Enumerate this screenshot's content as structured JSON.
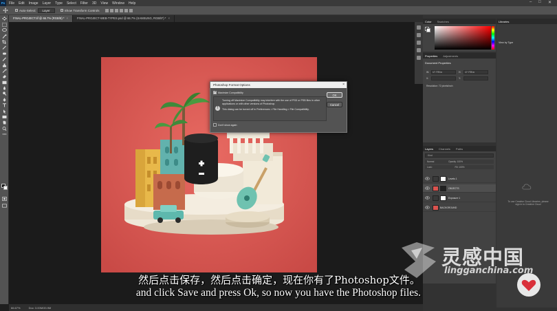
{
  "menu": {
    "app_logo": "Ps",
    "items": [
      "File",
      "Edit",
      "Image",
      "Layer",
      "Type",
      "Select",
      "Filter",
      "3D",
      "View",
      "Window",
      "Help"
    ]
  },
  "options_bar": {
    "auto_select_label": "Auto-Select:",
    "auto_select_value": "Layer",
    "show_transform_label": "Show Transform Controls"
  },
  "tabs": [
    {
      "label": "FINAL-PROJECT.tif @ 66.7% (RGB/8) *",
      "active": true
    },
    {
      "label": "FINAL-PROJECT-WEB-TYPES.psd @ 66.7% (SAMSUNG, RGB/8*) *",
      "active": false
    }
  ],
  "status_bar": {
    "zoom": "66.67%",
    "doc_info": "Doc: 3.00M/33.9M"
  },
  "dialog": {
    "title": "Photoshop Format Options",
    "close_glyph": "×",
    "maximize_label": "Maximize Compatibility",
    "info_text": "Turning off Maximize Compatibility may interfere with the use of PSD or PSB files in other applications or with other versions of Photoshop.",
    "info_text2": "This dialog can be turned off in Preferences > File Handling > File Compatibility.",
    "dont_show_label": "Don't show again",
    "ok_label": "OK",
    "cancel_label": "Cancel"
  },
  "color_panel": {
    "tabs": [
      "Color",
      "Swatches"
    ]
  },
  "properties_panel": {
    "tabs": [
      "Properties",
      "Adjustments"
    ],
    "doc_title": "Document Properties",
    "w_label": "W:",
    "w_value": "17.778 in",
    "h_label": "H:",
    "h_value": "17.778 in",
    "x_label": "X:",
    "y_label": "Y:",
    "resolution": "Resolution: 72 pixels/inch"
  },
  "layers_panel": {
    "tabs": [
      "Layers",
      "Channels",
      "Paths"
    ],
    "search_kind": "Kind",
    "mode": "Normal",
    "opacity": "Opacity: 100%",
    "lock": "Lock:",
    "fill": "Fill: 100%",
    "layers": [
      {
        "name": "Levels 1",
        "thumb_color": "#dddddd"
      },
      {
        "name": "OBJECTS",
        "thumb_color": "#222222"
      },
      {
        "name": "Exposure 1",
        "thumb_color": "#dddddd"
      },
      {
        "name": "BACKGROUND",
        "thumb_color": "#d9534f"
      }
    ]
  },
  "libraries_panel": {
    "title": "Libraries",
    "view_by": "View by Type",
    "message": "To use Creative Cloud Libraries, please sign in to Creative Cloud"
  },
  "watermark": {
    "text": "灵感中国",
    "subtext": "lingganchina.com"
  },
  "subtitles": {
    "zh": "然后点击保存，然后点击确定，现在你有了Photoshop文件。",
    "en": "and click Save and press Ok, so now you have the Photoshop files."
  },
  "colors": {
    "canvas_bg": "#d9534f",
    "ps_blue": "#31a8ff"
  }
}
